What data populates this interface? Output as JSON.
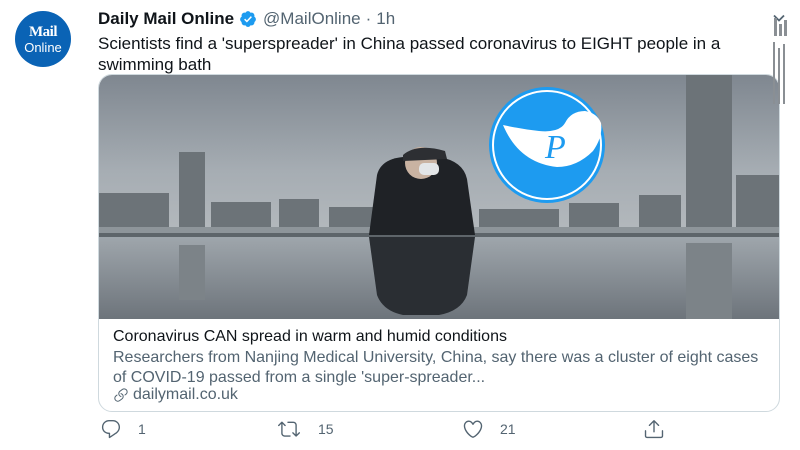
{
  "account": {
    "avatar_line1": "Mail",
    "avatar_line2": "Online",
    "name": "Daily Mail Online",
    "handle": "@MailOnline",
    "separator": "·",
    "time": "1h"
  },
  "tweet": {
    "text": "Scientists find a 'superspreader' in China passed coronavirus to EIGHT people in a swimming bath"
  },
  "card": {
    "title": "Coronavirus CAN spread in warm and humid conditions",
    "description": "Researchers from Nanjing Medical University, China, say there was a cluster of eight cases of COVID-19 passed from a single 'super-spreader...",
    "domain": "dailymail.co.uk"
  },
  "actions": {
    "replies": "1",
    "retweets": "15",
    "likes": "21"
  },
  "icons": [
    "verified-badge-icon",
    "chevron-down-icon",
    "reply-icon",
    "retweet-icon",
    "like-icon",
    "share-icon",
    "link-icon"
  ],
  "colors": {
    "accent": "#1d9bf0",
    "brand": "#0a63b5",
    "secondary_text": "#536471"
  }
}
